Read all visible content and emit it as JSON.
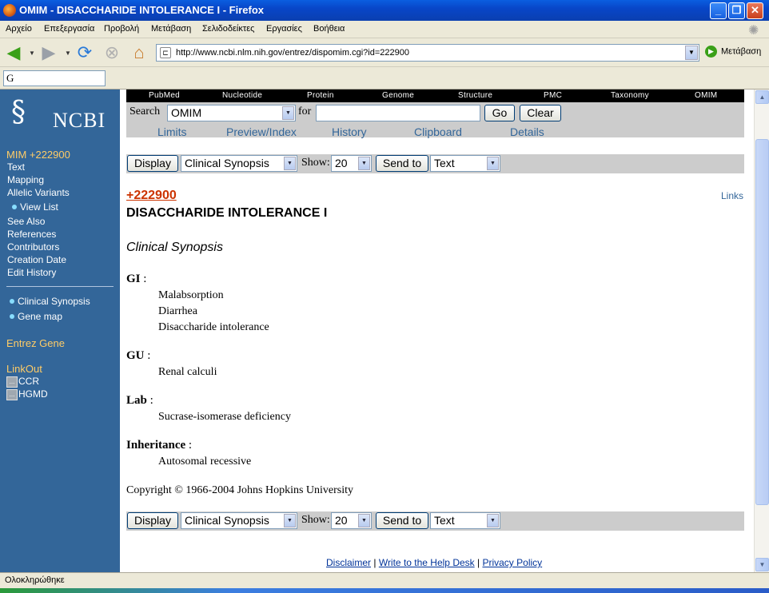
{
  "window": {
    "title": "OMIM - DISACCHARIDE INTOLERANCE I - Firefox",
    "minimize": "_",
    "maximize": "❐",
    "close": "✕"
  },
  "menu": [
    "Αρχείο",
    "Επεξεργασία",
    "Προβολή",
    "Μετάβαση",
    "Σελιδοδείκτες",
    "Εργασίες",
    "Βοήθεια"
  ],
  "nav": {
    "url": "http://www.ncbi.nlm.nih.gov/entrez/dispomim.cgi?id=222900",
    "go_label": "Μετάβαση"
  },
  "search_toolbar": {
    "engine_glyph": "G"
  },
  "sidebar": {
    "logo_text": "NCBI",
    "mim": "MIM +222900",
    "links": [
      "Text",
      "Mapping",
      "Allelic Variants",
      "View List",
      "See Also",
      "References",
      "Contributors",
      "Creation Date",
      "Edit History"
    ],
    "sub_links": [
      "Clinical Synopsis",
      "Gene map"
    ],
    "entrez_gene": "Entrez Gene",
    "linkout": "LinkOut",
    "linkout_items": [
      "CCR",
      "HGMD"
    ],
    "linkout_box": "..."
  },
  "topnav": [
    "PubMed",
    "Nucleotide",
    "Protein",
    "Genome",
    "Structure",
    "PMC",
    "Taxonomy",
    "OMIM"
  ],
  "search": {
    "label": "Search",
    "db": "OMIM",
    "for_label": "for",
    "go": "Go",
    "clear": "Clear",
    "sublinks": [
      "Limits",
      "Preview/Index",
      "History",
      "Clipboard",
      "Details"
    ]
  },
  "toolbar": {
    "display": "Display",
    "format": "Clinical Synopsis",
    "show_label": "Show:",
    "show_value": "20",
    "send_to": "Send to",
    "send_format": "Text"
  },
  "record": {
    "mim_number": "+222900",
    "links": "Links",
    "title": "DISACCHARIDE INTOLERANCE I",
    "subtitle": "Clinical Synopsis",
    "sections": [
      {
        "heading": "GI",
        "items": [
          "Malabsorption",
          "Diarrhea",
          "Disaccharide intolerance"
        ]
      },
      {
        "heading": "GU",
        "items": [
          "Renal calculi"
        ]
      },
      {
        "heading": "Lab",
        "items": [
          "Sucrase-isomerase deficiency"
        ]
      },
      {
        "heading": "Inheritance",
        "items": [
          "Autosomal recessive"
        ]
      }
    ],
    "copyright": "Copyright © 1966-2004 Johns Hopkins University"
  },
  "footer": {
    "disclaimer": "Disclaimer",
    "help": "Write to the Help Desk",
    "privacy": "Privacy Policy",
    "sep": "|"
  },
  "status": "Ολοκληρώθηκε",
  "colors": {
    "sidebar": "#336699",
    "accent": "#ffcc66",
    "mim_red": "#cc3300",
    "link": "#336699"
  }
}
